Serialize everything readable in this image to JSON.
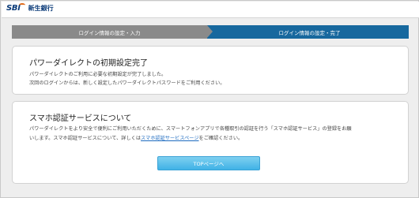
{
  "header": {
    "logo_mark": "SBI",
    "logo_text": "新生銀行"
  },
  "steps": [
    {
      "label": "ログイン情報の設定・入力",
      "state": "done"
    },
    {
      "label": "ログイン情報の設定・完了",
      "state": "current"
    }
  ],
  "complete_card": {
    "title": "パワーダイレクトの初期設定完了",
    "line1": "パワーダイレクトのご利用に必要な初期設定が完了しました。",
    "line2": "次回のログインからは、新しく設定したパワーダイレクトパスワードをご利用ください。"
  },
  "sumaho_card": {
    "title": "スマホ認証サービスについて",
    "line1": "パワーダイレクトをより安全で便利にご利用いただくために、スマートフォンアプリで各種取引の認証を行う「スマホ認証サービス」の登録をお願",
    "line2_prefix": "いします。スマホ認証サービスについて、詳しくは",
    "line2_link": "スマホ認証サービスページ",
    "line2_suffix": "をご確認ください。",
    "button_label": "TOPページへ"
  },
  "colors": {
    "step_done": "#8a8a8a",
    "step_current": "#17689e",
    "button": "#3fb2e6",
    "link": "#1f6cc0",
    "brand_orange": "#e06a1a",
    "brand_navy": "#0a3a78"
  }
}
